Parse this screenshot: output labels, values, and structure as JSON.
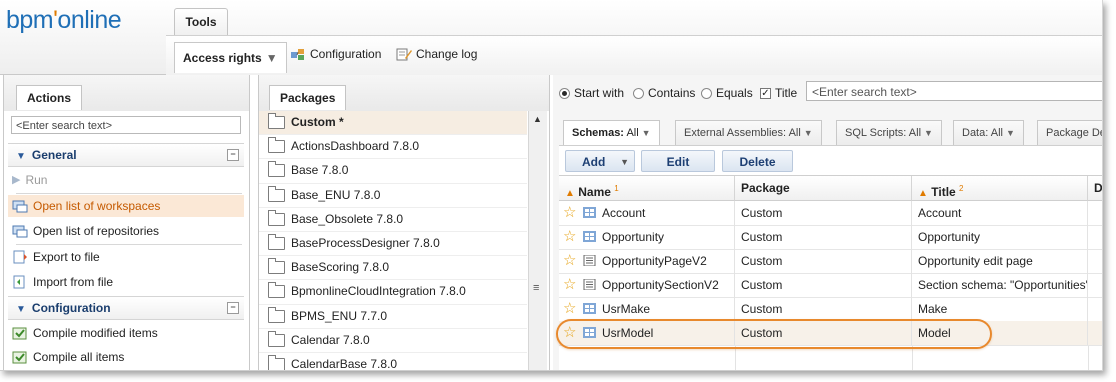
{
  "app": {
    "logo_text": "bpm",
    "logo_dot": "'",
    "logo_rest": "online"
  },
  "top_tabs": {
    "tools": "Tools"
  },
  "toolbar": {
    "access_rights": "Access rights",
    "configuration": "Configuration",
    "change_log": "Change log"
  },
  "actions": {
    "tab": "Actions",
    "search_placeholder": "<Enter search text>",
    "groups": [
      {
        "label": "General",
        "items": [
          "Run",
          "Open list of workspaces",
          "Open list of repositories",
          "Export to file",
          "Import from file"
        ]
      },
      {
        "label": "Configuration",
        "items": [
          "Compile modified items",
          "Compile all items"
        ]
      }
    ]
  },
  "packages": {
    "tab": "Packages",
    "items": [
      "Custom *",
      "ActionsDashboard 7.8.0",
      "Base 7.8.0",
      "Base_ENU 7.8.0",
      "Base_Obsolete 7.8.0",
      "BaseProcessDesigner 7.8.0",
      "BaseScoring 7.8.0",
      "BpmonlineCloudIntegration 7.8.0",
      "BPMS_ENU 7.7.0",
      "Calendar 7.8.0",
      "CalendarBase 7.8.0"
    ]
  },
  "filter": {
    "start_with": "Start with",
    "contains": "Contains",
    "equals": "Equals",
    "title": "Title",
    "search_placeholder": "<Enter search text>"
  },
  "tabs": [
    {
      "label": "Schemas:",
      "value": "All"
    },
    {
      "label": "External Assemblies:",
      "value": "All"
    },
    {
      "label": "SQL Scripts:",
      "value": "All"
    },
    {
      "label": "Data:",
      "value": "All"
    },
    {
      "label": "Package Dep",
      "value": ""
    }
  ],
  "buttons": {
    "add": "Add",
    "edit": "Edit",
    "delete": "Delete"
  },
  "grid": {
    "headers": {
      "name": "Name",
      "name_sort": "1",
      "package": "Package",
      "title": "Title",
      "title_sort": "2",
      "extra": "D"
    },
    "rows": [
      {
        "name": "Account",
        "package": "Custom",
        "title": "Account",
        "icon": "object-icon"
      },
      {
        "name": "Opportunity",
        "package": "Custom",
        "title": "Opportunity",
        "icon": "object-icon"
      },
      {
        "name": "OpportunityPageV2",
        "package": "Custom",
        "title": "Opportunity edit page",
        "icon": "page-icon"
      },
      {
        "name": "OpportunitySectionV2",
        "package": "Custom",
        "title": "Section schema: \"Opportunities\"",
        "icon": "page-icon"
      },
      {
        "name": "UsrMake",
        "package": "Custom",
        "title": "Make",
        "icon": "object-icon"
      },
      {
        "name": "UsrModel",
        "package": "Custom",
        "title": "Model",
        "icon": "object-icon"
      }
    ]
  },
  "colors": {
    "accent_orange": "#e8892d",
    "brand_blue": "#1f6fb6",
    "selected_row": "#f7f1e9"
  }
}
